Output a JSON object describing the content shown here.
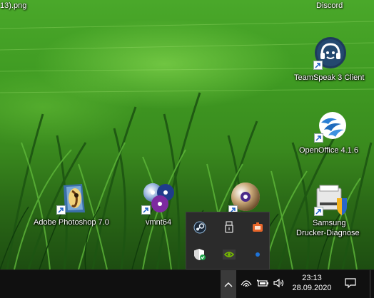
{
  "desktop": {
    "top_left_label": "13).png",
    "top_right_label": "Discord",
    "icons": [
      {
        "label": "TeamSpeak 3 Client",
        "icon": "teamspeak-icon"
      },
      {
        "label": "OpenOffice 4.1.6",
        "icon": "openoffice-icon"
      },
      {
        "label": "Adobe Photoshop 7.0",
        "icon": "photoshop-icon"
      },
      {
        "label": "vmnt64",
        "icon": "vmnt-icon"
      },
      {
        "label": "",
        "icon": "disc-tool-icon"
      },
      {
        "label_line1": "Samsung",
        "label_line2": "Drucker-Diagnose",
        "icon": "samsung-printer-icon"
      }
    ]
  },
  "tray_flyout": {
    "icons": [
      "steam-icon",
      "usb-icon",
      "orange-app-icon",
      "security-shield-icon",
      "nvidia-icon",
      "bluetooth-icon"
    ]
  },
  "taskbar": {
    "time": "23:13",
    "date": "28.09.2020",
    "tray_icons": [
      "chevron-up-icon",
      "wifi-icon",
      "battery-icon",
      "speaker-icon",
      "notification-icon"
    ]
  },
  "colors": {
    "taskbar_bg": "#101010",
    "flyout_bg": "#2b2b2b",
    "wallpaper_green": "#3f9a22"
  }
}
